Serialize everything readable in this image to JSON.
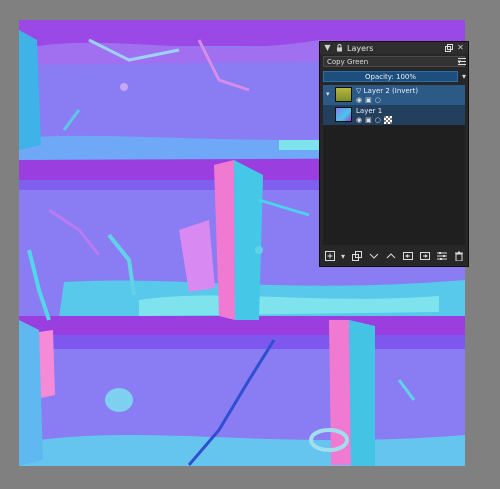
{
  "layers_docker": {
    "title": "Layers",
    "blend_mode": "Copy Green",
    "opacity_label": "Opacity:",
    "opacity_value": "100%",
    "layers": [
      {
        "name": "Layer 2 (Invert)",
        "type": "filter",
        "selected": true
      },
      {
        "name": "Layer 1",
        "type": "paint",
        "selected": false
      }
    ]
  },
  "colors": {
    "canvas_background": "#808080",
    "docker_background": "#272727",
    "selection": "#2b5a86",
    "texture_purple": "#8a7cf2",
    "texture_violet": "#9a3ee0",
    "texture_cyan": "#45d4e6",
    "texture_pink": "#f07ad2"
  }
}
